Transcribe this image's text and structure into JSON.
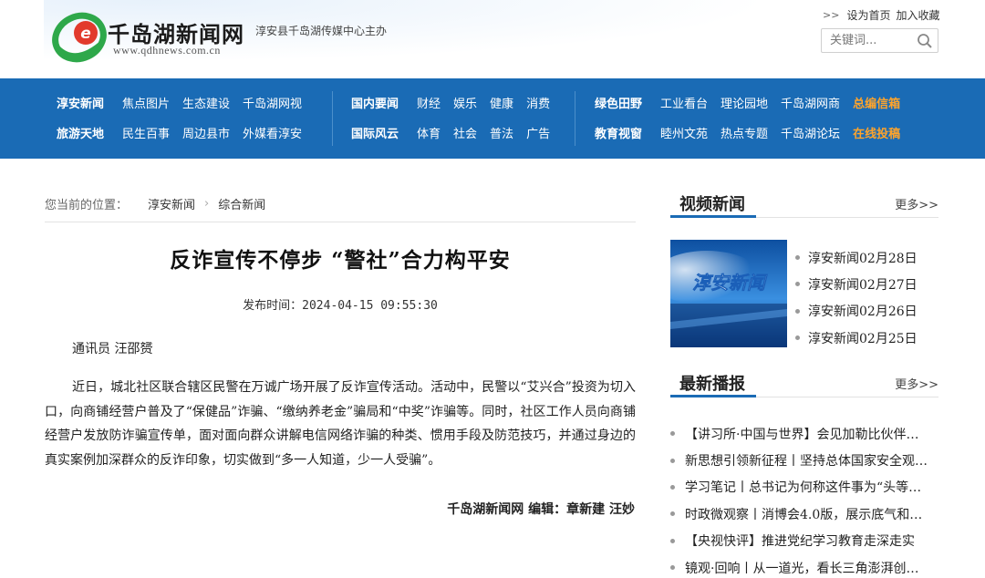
{
  "header": {
    "site_name": "千岛湖新闻网",
    "site_url": "www.qdhnews.com.cn",
    "sponsor": "淳安县千岛湖传媒中心主办",
    "links": [
      "设为首页",
      "加入收藏"
    ],
    "search_placeholder": "关键词..."
  },
  "nav": {
    "groups": [
      {
        "rows": [
          {
            "main": "淳安新闻",
            "items": [
              "焦点图片",
              "生态建设",
              "千岛湖网视"
            ]
          },
          {
            "main": "旅游天地",
            "items": [
              "民生百事",
              "周边县市",
              "外媒看淳安"
            ]
          }
        ]
      },
      {
        "rows": [
          {
            "main": "国内要闻",
            "items": [
              "财经",
              "娱乐",
              "健康",
              "消费"
            ]
          },
          {
            "main": "国际风云",
            "items": [
              "体育",
              "社会",
              "普法",
              "广告"
            ]
          }
        ]
      },
      {
        "rows": [
          {
            "main": "绿色田野",
            "items": [
              "工业看台",
              "理论园地",
              "千岛湖网商"
            ],
            "special": "总编信箱"
          },
          {
            "main": "教育视窗",
            "items": [
              "睦州文苑",
              "热点专题",
              "千岛湖论坛"
            ],
            "special": "在线投稿"
          }
        ]
      }
    ]
  },
  "breadcrumb": {
    "label": "您当前的位置：",
    "items": [
      "淳安新闻",
      "综合新闻"
    ]
  },
  "article": {
    "title": "反诈宣传不停步 “警社”合力构平安",
    "publish_label": "发布时间：",
    "publish_time": "2024-04-15 09:55:30",
    "author": "通讯员 汪邵赟",
    "body": "近日，城北社区联合辖区民警在万诚广场开展了反诈宣传活动。活动中，民警以“艾兴合”投资为切入口，向商铺经营户普及了“保健品”诈骗、“缴纳养老金”骗局和“中奖”诈骗等。同时，社区工作人员向商铺经营户发放防诈骗宣传单，面对面向群众讲解电信网络诈骗的种类、惯用手段及防范技巧，并通过身边的真实案例加深群众的反诈印象，切实做到“多一人知道，少一人受骗”。",
    "credit": "千岛湖新闻网 编辑：章新建 汪妙"
  },
  "video_news": {
    "title": "视频新闻",
    "more": "更多>>",
    "thumb_text": "淳安新闻",
    "items": [
      "淳安新闻02月28日",
      "淳安新闻02月27日",
      "淳安新闻02月26日",
      "淳安新闻02月25日"
    ]
  },
  "latest": {
    "title": "最新播报",
    "more": "更多>>",
    "items": [
      "【讲习所·中国与世界】会见加勒比伙伴…",
      "新思想引领新征程丨坚持总体国家安全观…",
      "学习笔记丨总书记为何称这件事为“头等…",
      "时政微观察丨消博会4.0版，展示底气和…",
      "【央视快评】推进党纪学习教育走深走实",
      "镜观·回响丨从一道光，看长三角澎湃创…"
    ]
  },
  "colors": {
    "nav_bg": "#1a6bb5",
    "nav_special": "#ffa42b",
    "accent_bar": "#1a6bb5",
    "logo_green": "#2ea84a",
    "logo_red": "#e23a2d"
  }
}
